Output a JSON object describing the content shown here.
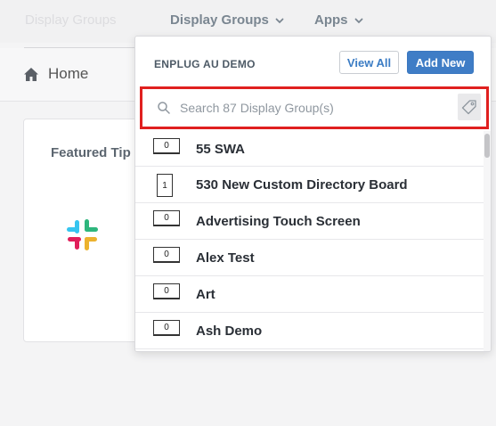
{
  "nav": {
    "faded_label": "Display Groups",
    "display_groups_label": "Display Groups",
    "apps_label": "Apps"
  },
  "breadcrumb": {
    "home_label": "Home"
  },
  "card": {
    "title": "Featured Tip"
  },
  "dropdown": {
    "org_name": "ENPLUG AU DEMO",
    "view_all_label": "View All",
    "add_new_label": "Add New",
    "search_placeholder": "Search 87 Display Group(s)",
    "items": [
      {
        "count": "0",
        "label": "55 SWA",
        "orientation": "landscape"
      },
      {
        "count": "1",
        "label": "530 New Custom Directory Board",
        "orientation": "portrait"
      },
      {
        "count": "0",
        "label": "Advertising Touch Screen",
        "orientation": "landscape"
      },
      {
        "count": "0",
        "label": "Alex Test",
        "orientation": "landscape"
      },
      {
        "count": "0",
        "label": "Art",
        "orientation": "landscape"
      },
      {
        "count": "0",
        "label": "Ash Demo",
        "orientation": "landscape"
      }
    ]
  },
  "icons": {
    "home": "home-icon",
    "search": "search-icon",
    "tag": "tag-icon",
    "chevron": "chevron-down-icon",
    "slack": "slack-logo"
  },
  "colors": {
    "accent": "#3f7dc6",
    "highlight": "#e0201f",
    "nav_text": "#7a8691"
  }
}
